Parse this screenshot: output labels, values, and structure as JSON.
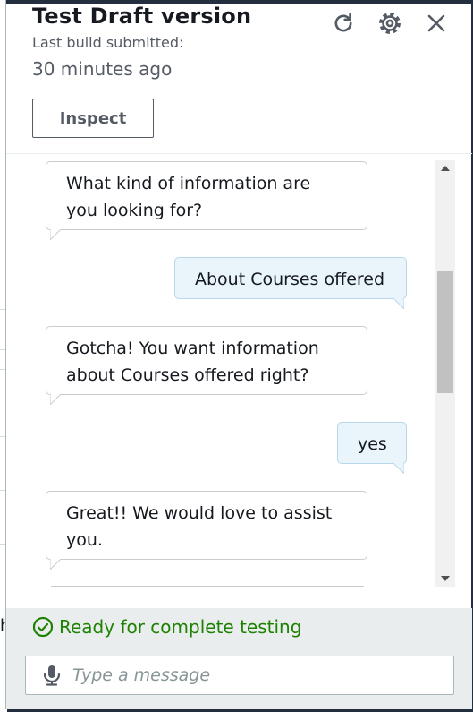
{
  "panel": {
    "title": "Test Draft version",
    "subtitle": "Last build submitted:",
    "build_time": "30 minutes ago",
    "inspect_label": "Inspect"
  },
  "chat": {
    "messages": [
      {
        "from": "bot",
        "line1": "What kind of information are",
        "line2": "you looking for?"
      },
      {
        "from": "user",
        "line1": "About Courses offered"
      },
      {
        "from": "bot",
        "line1": "Gotcha! You want information",
        "line2": "about Courses offered right?"
      },
      {
        "from": "user",
        "line1": "yes"
      },
      {
        "from": "bot",
        "line1": "Great!! We would love to assist",
        "line2": "you."
      }
    ]
  },
  "footer": {
    "status_text": "Ready for complete testing",
    "input_placeholder": "Type a message",
    "input_value": ""
  },
  "background": {
    "partial_text": "h"
  },
  "icons": [
    "refresh-icon",
    "gear-icon",
    "close-icon",
    "check-circle-icon",
    "microphone-icon",
    "scroll-up-icon",
    "scroll-down-icon"
  ],
  "colors": {
    "status_green": "#1d8102",
    "user_bubble": "#e9f4fb",
    "footer_bg": "#eaeded",
    "dark_bar": "#232f3e"
  }
}
